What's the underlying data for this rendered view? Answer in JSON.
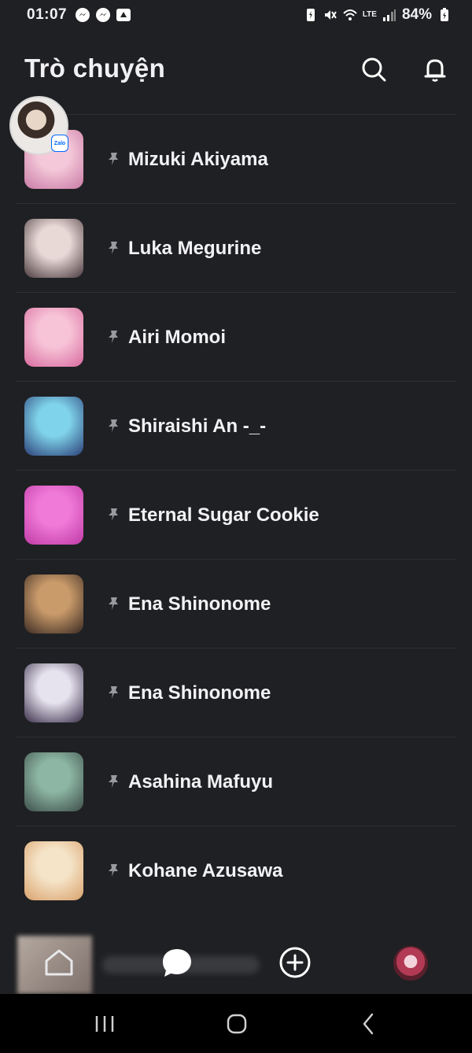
{
  "status_bar": {
    "time": "01:07",
    "battery": "84%",
    "network_label": "LTE"
  },
  "header": {
    "title": "Trò chuyện"
  },
  "floating_bubble": {
    "badge": "Zalo"
  },
  "chats": [
    {
      "name": "Mizuki Akiyama",
      "colors": [
        "#f4c8d8",
        "#c97aa6"
      ]
    },
    {
      "name": "Luka Megurine",
      "colors": [
        "#e8d9d6",
        "#4a3a3f"
      ]
    },
    {
      "name": "Airi Momoi",
      "colors": [
        "#f7c3d6",
        "#d86aa0"
      ]
    },
    {
      "name": "Shiraishi An -_-",
      "colors": [
        "#7fd3ea",
        "#2b3f78"
      ]
    },
    {
      "name": "Eternal Sugar Cookie",
      "colors": [
        "#f07ad8",
        "#c03aa6"
      ]
    },
    {
      "name": "Ena Shinonome",
      "colors": [
        "#c99a6a",
        "#3a2a22"
      ]
    },
    {
      "name": "Ena Shinonome",
      "colors": [
        "#e6e2ee",
        "#3a2f4a"
      ]
    },
    {
      "name": "Asahina Mafuyu",
      "colors": [
        "#8db6a4",
        "#3d4e4a"
      ]
    },
    {
      "name": "Kohane Azusawa",
      "colors": [
        "#f5e4c8",
        "#d9a26c"
      ]
    }
  ]
}
